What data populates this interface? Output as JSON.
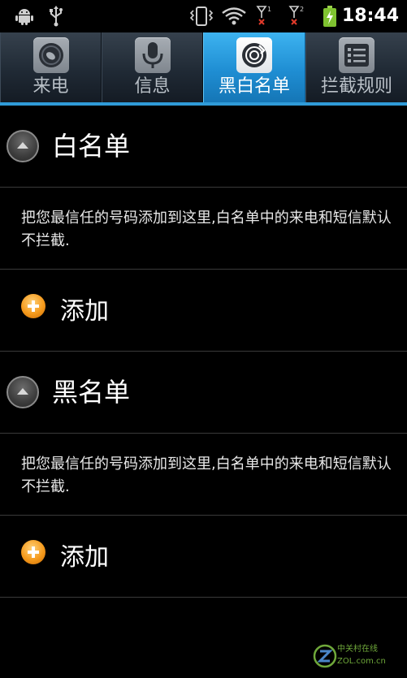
{
  "status_bar": {
    "time": "18:44",
    "icons": [
      "android-debug-icon",
      "usb-icon",
      "vibrate-icon",
      "wifi-icon",
      "sim1-no-signal-icon",
      "sim2-no-signal-icon",
      "battery-charging-icon"
    ]
  },
  "tabs": [
    {
      "label": "来电",
      "icon": "incoming-call-icon",
      "active": false
    },
    {
      "label": "信息",
      "icon": "microphone-message-icon",
      "active": false
    },
    {
      "label": "黑白名单",
      "icon": "blacklist-whitelist-icon",
      "active": true
    },
    {
      "label": "拦截规则",
      "icon": "rules-list-icon",
      "active": false
    }
  ],
  "sections": [
    {
      "title": "白名单",
      "description": "把您最信任的号码添加到这里,白名单中的来电和短信默认不拦截.",
      "add_label": "添加"
    },
    {
      "title": "黑名单",
      "description": "把您最信任的号码添加到这里,白名单中的来电和短信默认不拦截.",
      "add_label": "添加"
    }
  ],
  "watermark": {
    "cn": "中关村在线",
    "en": "ZOL.com.cn"
  },
  "colors": {
    "accent": "#2f9bd8",
    "add_button": "#f59a1c",
    "watermark": "#6fa83a"
  }
}
